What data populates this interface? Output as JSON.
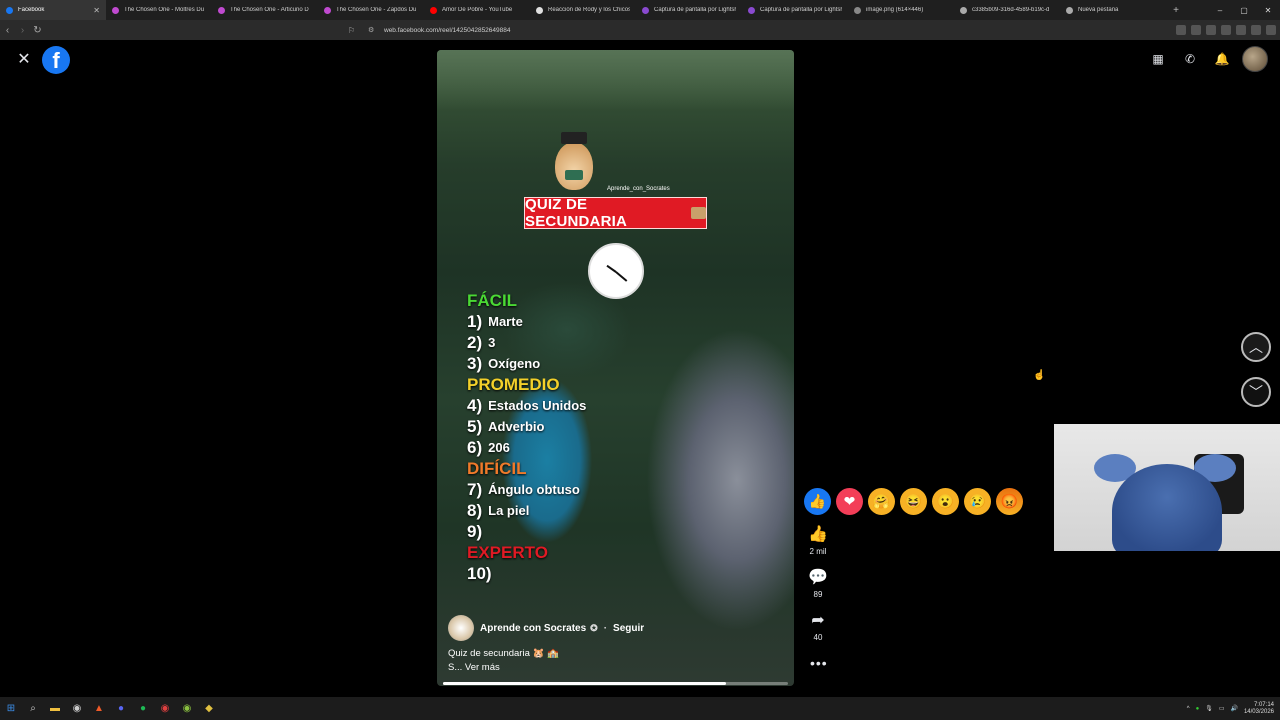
{
  "browser": {
    "tabs": [
      {
        "label": "Facebook",
        "fav_color": "#1877f2",
        "active": true
      },
      {
        "label": "The Chosen One - Moltres Du",
        "fav_color": "#c04ad0"
      },
      {
        "label": "The Chosen One - Articuno D",
        "fav_color": "#c04ad0"
      },
      {
        "label": "The Chosen One - Zapdos Du",
        "fav_color": "#c04ad0"
      },
      {
        "label": "Amor De Pobre - YouTube",
        "fav_color": "#ff0000"
      },
      {
        "label": "Reacción de Rody y los Chicos",
        "fav_color": "#e0e0e0"
      },
      {
        "label": "Captura de pantalla por Lightsh",
        "fav_color": "#8a4ad0"
      },
      {
        "label": "Captura de pantalla por Lightsh",
        "fav_color": "#8a4ad0"
      },
      {
        "label": "image.png (614×446)",
        "fav_color": "#888888"
      },
      {
        "label": "c3385b09-316d-4589-b19c-d",
        "fav_color": "#aaaaaa"
      },
      {
        "label": "Nueva pestaña",
        "fav_color": "#aaaaaa"
      }
    ],
    "new_tab_icon": "+",
    "window_controls": [
      "–",
      "▢",
      "✕"
    ],
    "url": "web.facebook.com/reel/1425042852649884"
  },
  "facebook": {
    "close_icon": "✕",
    "logo_letter": "f",
    "top_right": {
      "menu_icon": "▦",
      "messenger_icon": "✆",
      "bell_icon": "🔔"
    }
  },
  "reel": {
    "channel_tag": "Aprende_con_Socrates",
    "title": "QUIZ DE SECUNDARIA",
    "levels": {
      "easy": "FÁCIL",
      "medium": "PROMEDIO",
      "hard": "DIFÍCIL",
      "expert": "EXPERTO"
    },
    "answers": [
      {
        "num": "1)",
        "text": "Marte"
      },
      {
        "num": "2)",
        "text": "3"
      },
      {
        "num": "3)",
        "text": "Oxígeno"
      },
      {
        "num": "4)",
        "text": "Estados Unidos"
      },
      {
        "num": "5)",
        "text": "Adverbio"
      },
      {
        "num": "6)",
        "text": "206"
      },
      {
        "num": "7)",
        "text": "Ángulo obtuso"
      },
      {
        "num": "8)",
        "text": "La piel"
      },
      {
        "num": "9)",
        "text": ""
      },
      {
        "num": "10)",
        "text": ""
      }
    ],
    "author": "Aprende con Socrates",
    "verified_icon": "✪",
    "follow_label": "Seguir",
    "caption_line1": "Quiz de secundaria 🐹 🏫",
    "caption_line2_prefix": "S...",
    "see_more": "Ver más",
    "progress": 0.82
  },
  "reactions": [
    "👍",
    "❤",
    "🤗",
    "😆",
    "😮",
    "😢",
    "😡"
  ],
  "actions": {
    "like_icon": "👍",
    "like_count": "2 mil",
    "comment_icon": "💬",
    "comment_count": "89",
    "share_icon": "➦",
    "share_count": "40",
    "more_icon": "•••"
  },
  "nav": {
    "up_icon": "︿",
    "down_icon": "﹀"
  },
  "taskbar": {
    "time": "7:07:14",
    "date": "14/03/2026"
  }
}
